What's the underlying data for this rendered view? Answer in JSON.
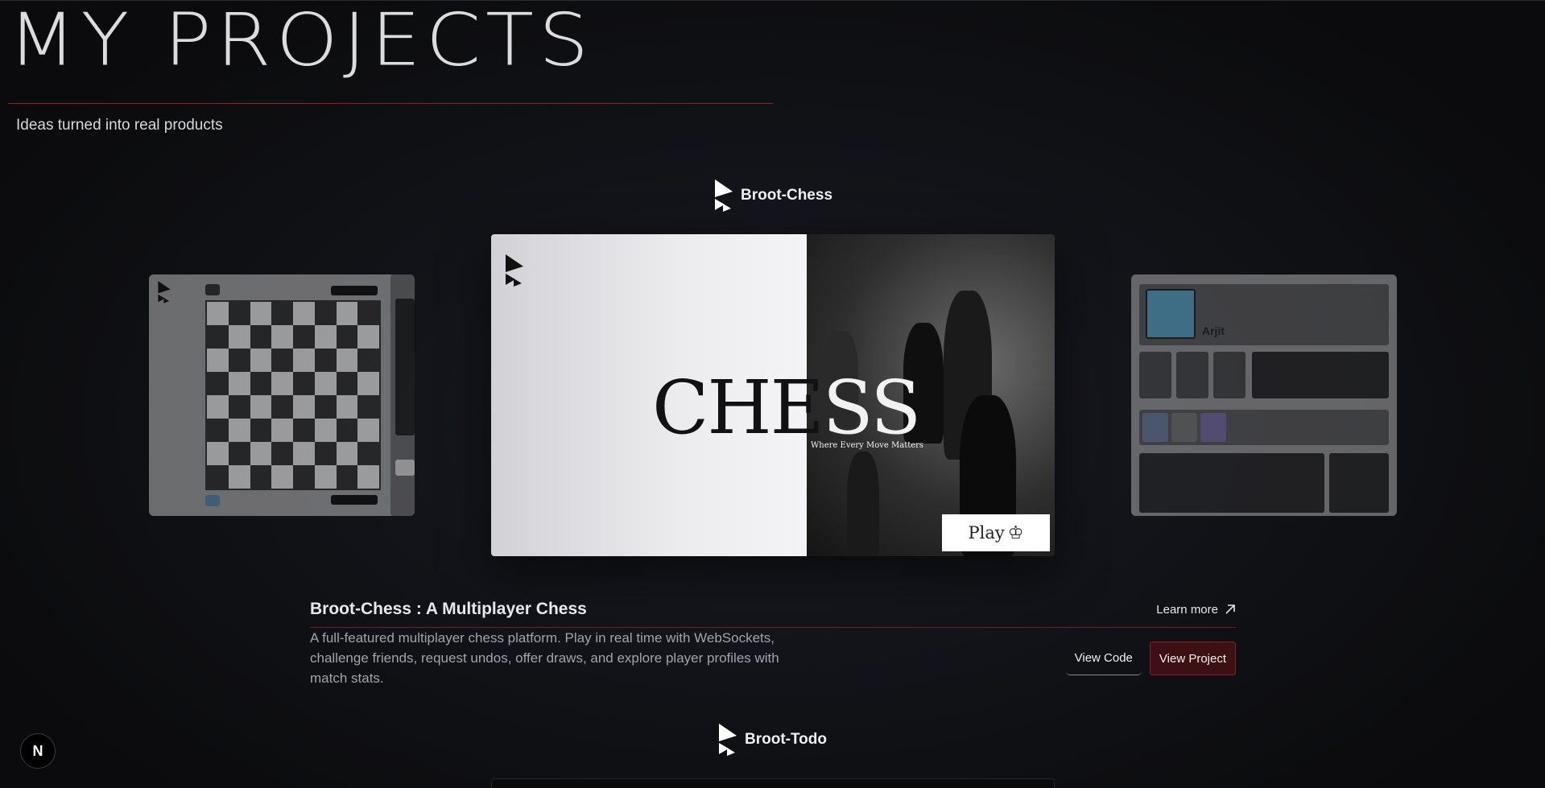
{
  "header": {
    "title": "MY PROJECTS",
    "subtitle": "Ideas turned into real products"
  },
  "project": {
    "name": "Broot-Chess",
    "title": "Broot-Chess : A Multiplayer Chess",
    "description": "A full-featured multiplayer chess platform. Play in real time with WebSockets, challenge friends, request undos, offer draws, and explore player profiles with match stats.",
    "learn_more": "Learn more",
    "view_code": "View Code",
    "view_project": "View Project",
    "hero": {
      "word_dark": "CHE",
      "word_light": "SS",
      "tagline": "Where Every Move Matters",
      "play_label": "Play",
      "play_icon": "chess-king-icon"
    },
    "preview_right": {
      "player_name": "Arjit"
    }
  },
  "next_project": {
    "name": "Broot-Todo"
  },
  "badge": {
    "label": "N"
  },
  "colors": {
    "accent": "#9c1a1a",
    "button_primary_bg": "#3d1114"
  }
}
